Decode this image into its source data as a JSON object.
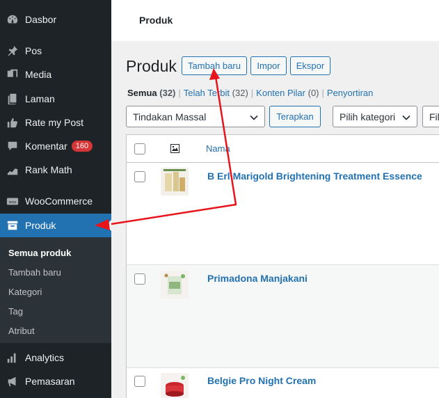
{
  "sidebar": {
    "items": [
      {
        "label": "Dasbor",
        "icon": "dashboard-icon"
      },
      {
        "label": "Pos",
        "icon": "pin-icon"
      },
      {
        "label": "Media",
        "icon": "media-icon"
      },
      {
        "label": "Laman",
        "icon": "pages-icon"
      },
      {
        "label": "Rate my Post",
        "icon": "thumbs-up-icon"
      },
      {
        "label": "Komentar",
        "icon": "comment-icon",
        "badge": "160"
      },
      {
        "label": "Rank Math",
        "icon": "rank-math-icon"
      },
      {
        "label": "WooCommerce",
        "icon": "woocommerce-icon"
      },
      {
        "label": "Produk",
        "icon": "archive-box-icon"
      },
      {
        "label": "Analytics",
        "icon": "bar-chart-icon"
      },
      {
        "label": "Pemasaran",
        "icon": "megaphone-icon"
      }
    ],
    "submenu": [
      "Semua produk",
      "Tambah baru",
      "Kategori",
      "Tag",
      "Atribut"
    ]
  },
  "topbar": {
    "title": "Produk"
  },
  "page": {
    "title": "Produk",
    "buttons": {
      "add_new": "Tambah baru",
      "import": "Impor",
      "export": "Ekspor"
    }
  },
  "views": {
    "all": {
      "label": "Semua",
      "count": "(32)"
    },
    "published": {
      "label": "Telah Terbit",
      "count": "(32)"
    },
    "cornerstone": {
      "label": "Konten Pilar",
      "count": "(0)"
    },
    "sorting": {
      "label": "Penyortiran"
    },
    "separator": "|"
  },
  "filters": {
    "bulk_action": "Tindakan Massal",
    "apply": "Terapkan",
    "category": "Pilih kategori",
    "filter_partial": "Filt"
  },
  "table": {
    "name_header": "Nama",
    "image_header_icon": "image-icon",
    "rows": [
      {
        "name": "B Erl Marigold Brightening Treatment Essence"
      },
      {
        "name": "Primadona Manjakani"
      },
      {
        "name": "Belgie Pro Night Cream"
      }
    ]
  },
  "colors": {
    "sidebar_bg": "#1d2327",
    "active_bg": "#2271b1",
    "link": "#2271b1",
    "badge": "#d63638",
    "arrow": "#e8141b"
  }
}
